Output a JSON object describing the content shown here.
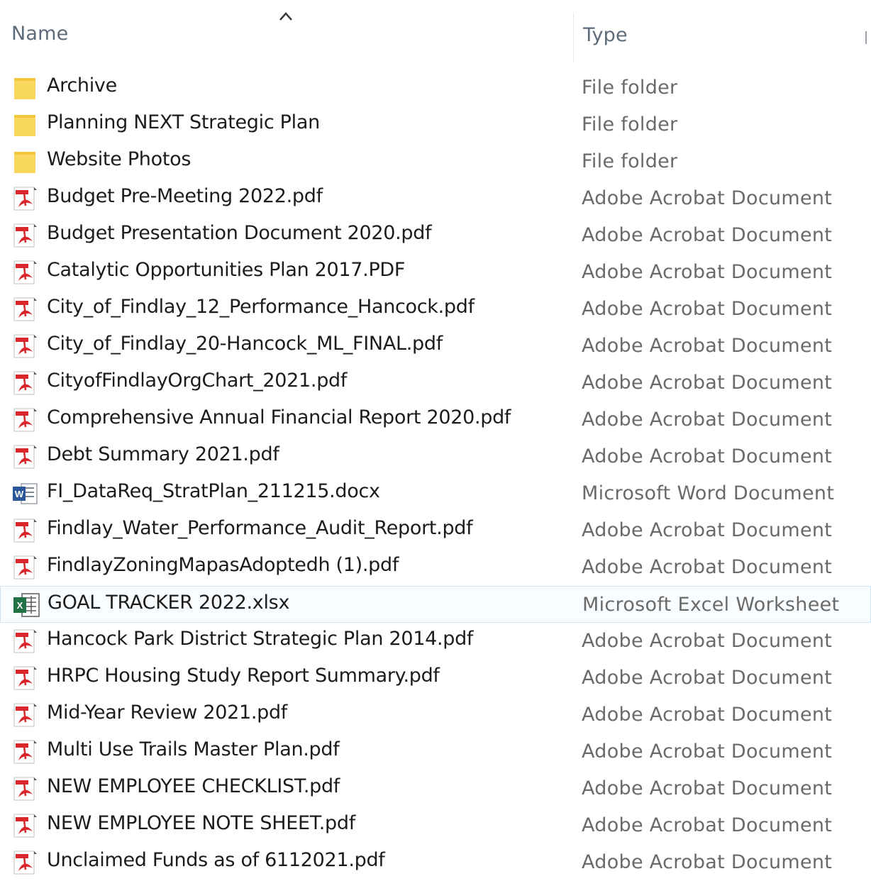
{
  "header": {
    "name_label": "Name",
    "type_label": "Type",
    "sort": "ascending-by-name"
  },
  "colors": {
    "folder": "#f9d65c",
    "pdf": "#d8262b",
    "word": "#2b579a",
    "excel": "#217346",
    "selection_border": "#cfe3f7"
  },
  "files": [
    {
      "name": "Archive",
      "type": "File folder",
      "icon": "folder-icon"
    },
    {
      "name": "Planning NEXT Strategic Plan",
      "type": "File folder",
      "icon": "folder-icon"
    },
    {
      "name": "Website Photos",
      "type": "File folder",
      "icon": "folder-icon"
    },
    {
      "name": "Budget Pre-Meeting 2022.pdf",
      "type": "Adobe Acrobat Document",
      "icon": "pdf-icon"
    },
    {
      "name": "Budget Presentation Document 2020.pdf",
      "type": "Adobe Acrobat Document",
      "icon": "pdf-icon"
    },
    {
      "name": "Catalytic Opportunities Plan 2017.PDF",
      "type": "Adobe Acrobat Document",
      "icon": "pdf-icon"
    },
    {
      "name": "City_of_Findlay_12_Performance_Hancock.pdf",
      "type": "Adobe Acrobat Document",
      "icon": "pdf-icon"
    },
    {
      "name": "City_of_Findlay_20-Hancock_ML_FINAL.pdf",
      "type": "Adobe Acrobat Document",
      "icon": "pdf-icon"
    },
    {
      "name": "CityofFindlayOrgChart_2021.pdf",
      "type": "Adobe Acrobat Document",
      "icon": "pdf-icon"
    },
    {
      "name": "Comprehensive Annual Financial Report 2020.pdf",
      "type": "Adobe Acrobat Document",
      "icon": "pdf-icon"
    },
    {
      "name": "Debt Summary 2021.pdf",
      "type": "Adobe Acrobat Document",
      "icon": "pdf-icon"
    },
    {
      "name": "FI_DataReq_StratPlan_211215.docx",
      "type": "Microsoft Word Document",
      "icon": "word-icon"
    },
    {
      "name": "Findlay_Water_Performance_Audit_Report.pdf",
      "type": "Adobe Acrobat Document",
      "icon": "pdf-icon"
    },
    {
      "name": "FindlayZoningMapasAdoptedh (1).pdf",
      "type": "Adobe Acrobat Document",
      "icon": "pdf-icon"
    },
    {
      "name": "GOAL TRACKER 2022.xlsx",
      "type": "Microsoft Excel Worksheet",
      "icon": "excel-icon",
      "selected": true
    },
    {
      "name": "Hancock Park District Strategic Plan 2014.pdf",
      "type": "Adobe Acrobat Document",
      "icon": "pdf-icon"
    },
    {
      "name": "HRPC Housing Study Report Summary.pdf",
      "type": "Adobe Acrobat Document",
      "icon": "pdf-icon"
    },
    {
      "name": "Mid-Year Review 2021.pdf",
      "type": "Adobe Acrobat Document",
      "icon": "pdf-icon"
    },
    {
      "name": "Multi Use Trails Master Plan.pdf",
      "type": "Adobe Acrobat Document",
      "icon": "pdf-icon"
    },
    {
      "name": "NEW EMPLOYEE CHECKLIST.pdf",
      "type": "Adobe Acrobat Document",
      "icon": "pdf-icon"
    },
    {
      "name": "NEW EMPLOYEE NOTE SHEET.pdf",
      "type": "Adobe Acrobat Document",
      "icon": "pdf-icon"
    },
    {
      "name": "Unclaimed Funds as of 6112021.pdf",
      "type": "Adobe Acrobat Document",
      "icon": "pdf-icon"
    }
  ]
}
